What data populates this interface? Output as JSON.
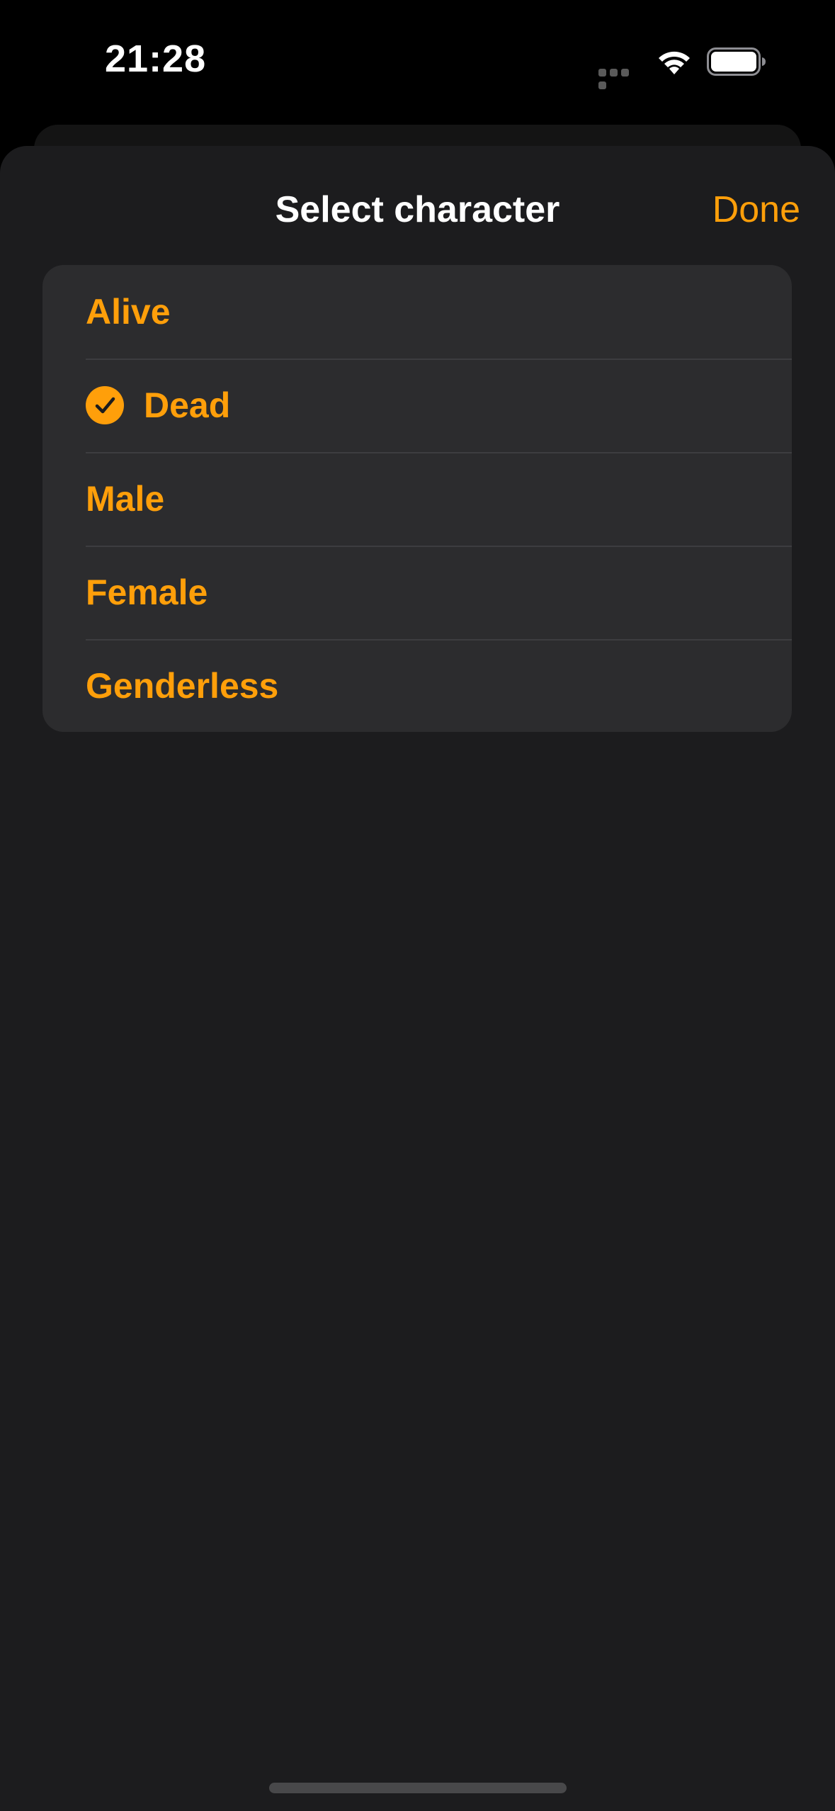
{
  "status_bar": {
    "time": "21:28",
    "icons": [
      "cellular-signal-icon",
      "wifi-icon",
      "battery-icon"
    ]
  },
  "sheet": {
    "title": "Select character",
    "done_label": "Done"
  },
  "options": [
    {
      "label": "Alive",
      "selected": false
    },
    {
      "label": "Dead",
      "selected": true
    },
    {
      "label": "Male",
      "selected": false
    },
    {
      "label": "Female",
      "selected": false
    },
    {
      "label": "Genderless",
      "selected": false
    }
  ],
  "colors": {
    "accent": "#ff9f0a",
    "sheet_background": "#1c1c1e",
    "list_background": "#2c2c2e",
    "title_text": "#ffffff"
  }
}
